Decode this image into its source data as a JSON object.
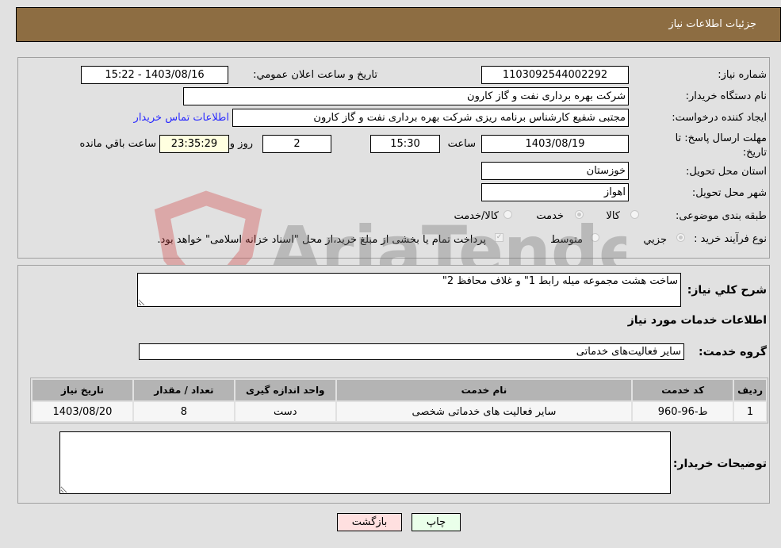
{
  "header": {
    "title": "جزئیات اطلاعات نیاز"
  },
  "details": {
    "need_number": {
      "label": "شماره نیاز:",
      "value": "1103092544002292"
    },
    "announce_datetime": {
      "label": "تاریخ و ساعت اعلان عمومي:",
      "value": "1403/08/16 - 15:22"
    },
    "buyer_org": {
      "label": "نام دستگاه خریدار:",
      "value": "شرکت بهره برداری نفت و گاز کارون"
    },
    "requester": {
      "label": "ایجاد کننده درخواست:",
      "value": "مجتبی شفیع کارشناس برنامه ریزی شرکت بهره برداری نفت و گاز کارون"
    },
    "buyer_contact_link": "اطلاعات تماس خریدار",
    "deadline": {
      "label": "مهلت ارسال پاسخ: تا تاریخ:",
      "date": "1403/08/19",
      "time_label": "ساعت",
      "time": "15:30",
      "days": "2",
      "days_label": "روز و",
      "remaining": "23:35:29",
      "remaining_label": "ساعت باقي مانده"
    },
    "province": {
      "label": "استان محل تحویل:",
      "value": "خوزستان"
    },
    "city": {
      "label": "شهر محل تحویل:",
      "value": "اهواز"
    },
    "category": {
      "label": "طبقه بندی موضوعی:",
      "options": [
        "کالا",
        "خدمت",
        "کالا/خدمت"
      ],
      "selected": "خدمت"
    },
    "purchase_type": {
      "label": "نوع فرآیند خرید :",
      "options": [
        "جزيي",
        "متوسط"
      ],
      "selected": "جزيي",
      "treasury_note": "پرداخت تمام یا بخشی از مبلغ خرید،از محل \"اسناد خزانه اسلامی\" خواهد بود."
    }
  },
  "description": {
    "label": "شرح كلي نياز:",
    "value": "ساخت هشت مجموعه میله رابط 1\" و غلاف محافظ 2\""
  },
  "services_section": {
    "title": "اطلاعات خدمات مورد نیاز",
    "group_label": "گروه خدمت:",
    "group_value": "سایر فعالیت‌های خدماتی"
  },
  "table": {
    "columns": [
      "ردیف",
      "کد خدمت",
      "نام خدمت",
      "واحد اندازه گیری",
      "تعداد / مقدار",
      "تاریخ نیاز"
    ],
    "rows": [
      [
        "1",
        "ط-96-960",
        "سایر فعالیت های خدماتی شخصی",
        "دست",
        "8",
        "1403/08/20"
      ]
    ]
  },
  "buyer_notes": {
    "label": "توضیحات خریدار:",
    "value": ""
  },
  "buttons": {
    "print": "چاپ",
    "back": "بازگشت"
  },
  "colors": {
    "header": "#8d6d42",
    "print_bg": "#eaffea",
    "back_bg": "#ffe0e0",
    "link": "#2a2aff"
  },
  "watermark": "AriaTender.neT"
}
